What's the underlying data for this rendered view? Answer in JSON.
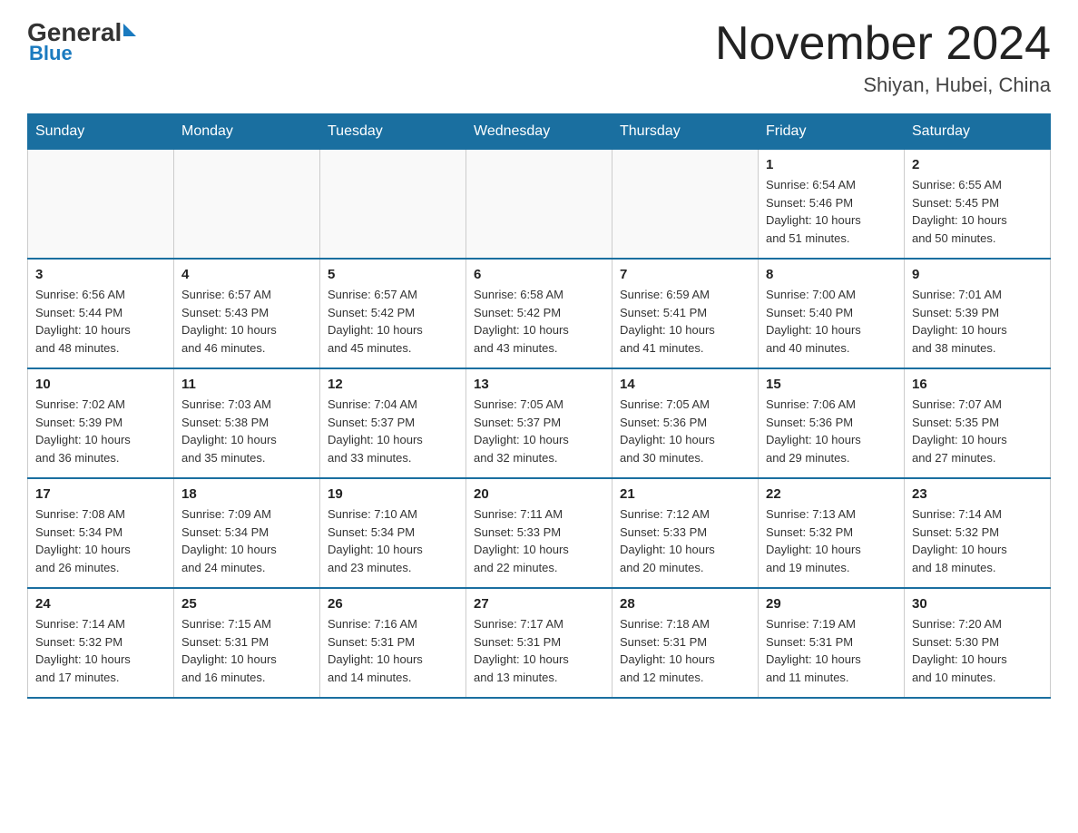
{
  "header": {
    "logo_general": "General",
    "logo_blue": "Blue",
    "title": "November 2024",
    "subtitle": "Shiyan, Hubei, China"
  },
  "days_of_week": [
    "Sunday",
    "Monday",
    "Tuesday",
    "Wednesday",
    "Thursday",
    "Friday",
    "Saturday"
  ],
  "weeks": [
    [
      {
        "day": "",
        "info": ""
      },
      {
        "day": "",
        "info": ""
      },
      {
        "day": "",
        "info": ""
      },
      {
        "day": "",
        "info": ""
      },
      {
        "day": "",
        "info": ""
      },
      {
        "day": "1",
        "info": "Sunrise: 6:54 AM\nSunset: 5:46 PM\nDaylight: 10 hours\nand 51 minutes."
      },
      {
        "day": "2",
        "info": "Sunrise: 6:55 AM\nSunset: 5:45 PM\nDaylight: 10 hours\nand 50 minutes."
      }
    ],
    [
      {
        "day": "3",
        "info": "Sunrise: 6:56 AM\nSunset: 5:44 PM\nDaylight: 10 hours\nand 48 minutes."
      },
      {
        "day": "4",
        "info": "Sunrise: 6:57 AM\nSunset: 5:43 PM\nDaylight: 10 hours\nand 46 minutes."
      },
      {
        "day": "5",
        "info": "Sunrise: 6:57 AM\nSunset: 5:42 PM\nDaylight: 10 hours\nand 45 minutes."
      },
      {
        "day": "6",
        "info": "Sunrise: 6:58 AM\nSunset: 5:42 PM\nDaylight: 10 hours\nand 43 minutes."
      },
      {
        "day": "7",
        "info": "Sunrise: 6:59 AM\nSunset: 5:41 PM\nDaylight: 10 hours\nand 41 minutes."
      },
      {
        "day": "8",
        "info": "Sunrise: 7:00 AM\nSunset: 5:40 PM\nDaylight: 10 hours\nand 40 minutes."
      },
      {
        "day": "9",
        "info": "Sunrise: 7:01 AM\nSunset: 5:39 PM\nDaylight: 10 hours\nand 38 minutes."
      }
    ],
    [
      {
        "day": "10",
        "info": "Sunrise: 7:02 AM\nSunset: 5:39 PM\nDaylight: 10 hours\nand 36 minutes."
      },
      {
        "day": "11",
        "info": "Sunrise: 7:03 AM\nSunset: 5:38 PM\nDaylight: 10 hours\nand 35 minutes."
      },
      {
        "day": "12",
        "info": "Sunrise: 7:04 AM\nSunset: 5:37 PM\nDaylight: 10 hours\nand 33 minutes."
      },
      {
        "day": "13",
        "info": "Sunrise: 7:05 AM\nSunset: 5:37 PM\nDaylight: 10 hours\nand 32 minutes."
      },
      {
        "day": "14",
        "info": "Sunrise: 7:05 AM\nSunset: 5:36 PM\nDaylight: 10 hours\nand 30 minutes."
      },
      {
        "day": "15",
        "info": "Sunrise: 7:06 AM\nSunset: 5:36 PM\nDaylight: 10 hours\nand 29 minutes."
      },
      {
        "day": "16",
        "info": "Sunrise: 7:07 AM\nSunset: 5:35 PM\nDaylight: 10 hours\nand 27 minutes."
      }
    ],
    [
      {
        "day": "17",
        "info": "Sunrise: 7:08 AM\nSunset: 5:34 PM\nDaylight: 10 hours\nand 26 minutes."
      },
      {
        "day": "18",
        "info": "Sunrise: 7:09 AM\nSunset: 5:34 PM\nDaylight: 10 hours\nand 24 minutes."
      },
      {
        "day": "19",
        "info": "Sunrise: 7:10 AM\nSunset: 5:34 PM\nDaylight: 10 hours\nand 23 minutes."
      },
      {
        "day": "20",
        "info": "Sunrise: 7:11 AM\nSunset: 5:33 PM\nDaylight: 10 hours\nand 22 minutes."
      },
      {
        "day": "21",
        "info": "Sunrise: 7:12 AM\nSunset: 5:33 PM\nDaylight: 10 hours\nand 20 minutes."
      },
      {
        "day": "22",
        "info": "Sunrise: 7:13 AM\nSunset: 5:32 PM\nDaylight: 10 hours\nand 19 minutes."
      },
      {
        "day": "23",
        "info": "Sunrise: 7:14 AM\nSunset: 5:32 PM\nDaylight: 10 hours\nand 18 minutes."
      }
    ],
    [
      {
        "day": "24",
        "info": "Sunrise: 7:14 AM\nSunset: 5:32 PM\nDaylight: 10 hours\nand 17 minutes."
      },
      {
        "day": "25",
        "info": "Sunrise: 7:15 AM\nSunset: 5:31 PM\nDaylight: 10 hours\nand 16 minutes."
      },
      {
        "day": "26",
        "info": "Sunrise: 7:16 AM\nSunset: 5:31 PM\nDaylight: 10 hours\nand 14 minutes."
      },
      {
        "day": "27",
        "info": "Sunrise: 7:17 AM\nSunset: 5:31 PM\nDaylight: 10 hours\nand 13 minutes."
      },
      {
        "day": "28",
        "info": "Sunrise: 7:18 AM\nSunset: 5:31 PM\nDaylight: 10 hours\nand 12 minutes."
      },
      {
        "day": "29",
        "info": "Sunrise: 7:19 AM\nSunset: 5:31 PM\nDaylight: 10 hours\nand 11 minutes."
      },
      {
        "day": "30",
        "info": "Sunrise: 7:20 AM\nSunset: 5:30 PM\nDaylight: 10 hours\nand 10 minutes."
      }
    ]
  ]
}
